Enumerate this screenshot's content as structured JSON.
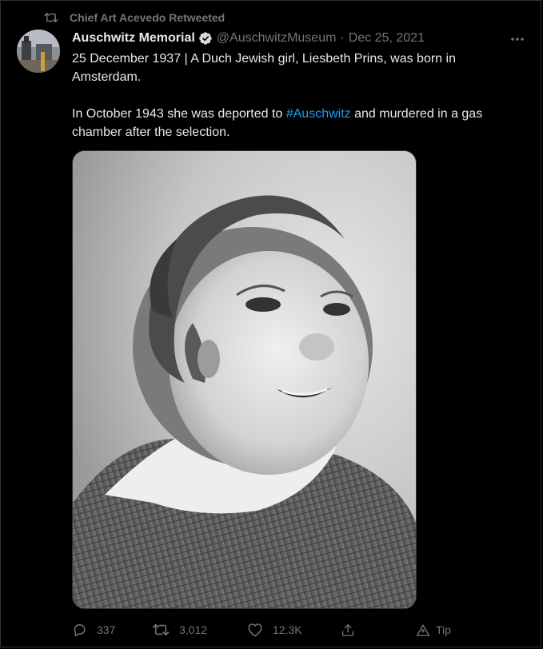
{
  "retweet": {
    "icon": "retweet-icon",
    "label": "Chief Art Acevedo Retweeted"
  },
  "tweet": {
    "author": {
      "display_name": "Auschwitz Memorial",
      "verified": true,
      "handle": "@AuschwitzMuseum",
      "separator": "·",
      "date": "Dec 25, 2021"
    },
    "more_icon": "more-horizontal-icon",
    "text": {
      "line1": "25 December 1937 | A Duch Jewish girl, Liesbeth Prins, was born in Amsterdam.",
      "line2_before": "In October 1943 she was deported to ",
      "hashtag": "#Auschwitz",
      "line2_after": " and murdered in a gas chamber after the selection."
    },
    "media": {
      "type": "photo",
      "description_icon": "black-and-white-portrait-photo"
    },
    "actions": {
      "reply_count": "337",
      "retweet_count": "3,012",
      "like_count": "12.3K",
      "share_icon": "share-icon",
      "tip_label": "Tip"
    }
  },
  "colors": {
    "background": "#000000",
    "primary_text": "#e7e9ea",
    "secondary_text": "#71767b",
    "link": "#1d9bf0",
    "verified_badge": "#d9d9d9"
  }
}
